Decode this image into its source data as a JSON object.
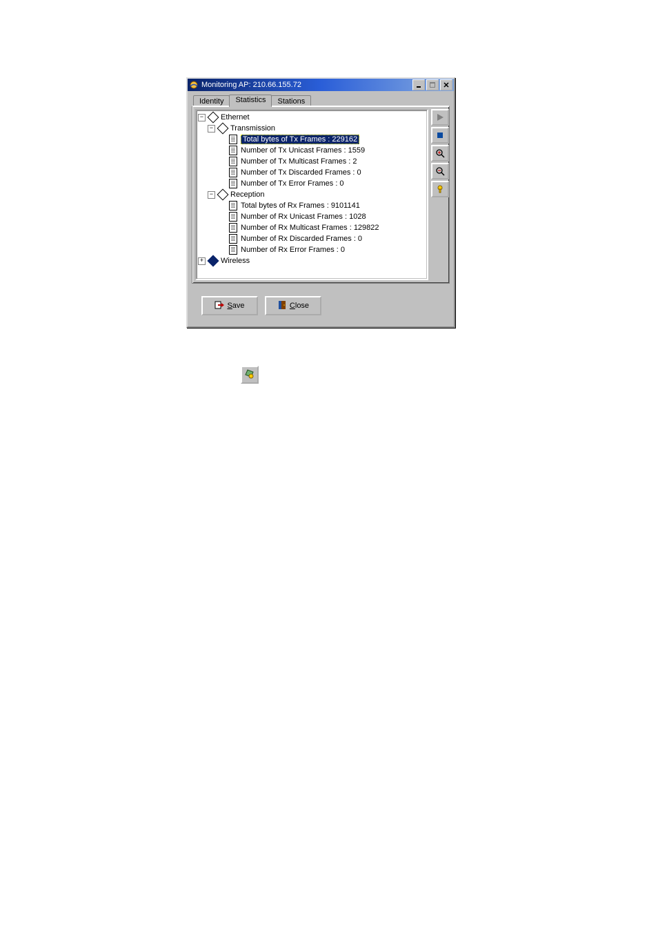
{
  "window": {
    "title": "Monitoring AP: 210.66.155.72"
  },
  "tabs": {
    "identity": "Identity",
    "statistics": "Statistics",
    "stations": "Stations"
  },
  "tree": {
    "ethernet": "Ethernet",
    "transmission": "Transmission",
    "tx_total_bytes": "Total bytes of Tx Frames : 229162",
    "tx_unicast": "Number of Tx Unicast Frames : 1559",
    "tx_multicast": "Number of Tx Multicast Frames : 2",
    "tx_discarded": "Number of Tx Discarded Frames : 0",
    "tx_error": "Number of Tx Error Frames : 0",
    "reception": "Reception",
    "rx_total_bytes": "Total bytes of Rx Frames : 9101141",
    "rx_unicast": "Number of Rx Unicast Frames : 1028",
    "rx_multicast": "Number of Rx Multicast Frames : 129822",
    "rx_discarded": "Number of Rx Discarded Frames : 0",
    "rx_error": "Number of Rx Error Frames : 0",
    "wireless": "Wireless"
  },
  "buttons": {
    "save": "Save",
    "close": "Close"
  },
  "toggle": {
    "minus": "−",
    "plus": "+"
  }
}
